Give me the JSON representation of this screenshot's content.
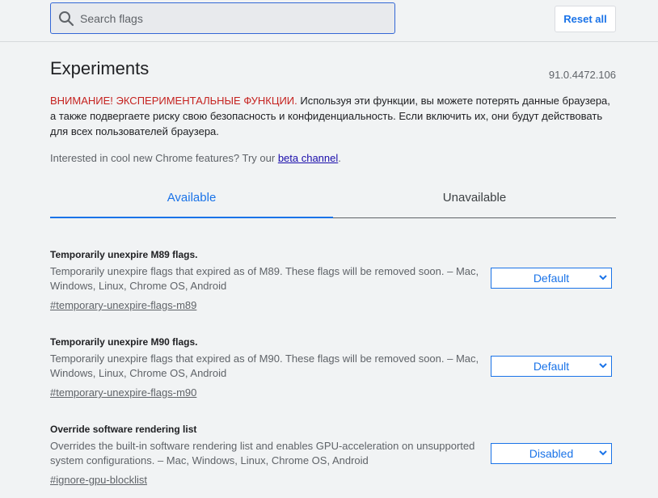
{
  "search": {
    "placeholder": "Search flags"
  },
  "header": {
    "reset_label": "Reset all"
  },
  "page": {
    "title": "Experiments",
    "version": "91.0.4472.106",
    "warning_red": "ВНИМАНИЕ! ЭКСПЕРИМЕНТАЛЬНЫЕ ФУНКЦИИ.",
    "warning_text": " Используя эти функции, вы можете потерять данные браузера, а также подвергаете риску свою безопасность и конфиденциальность. Если включить их, они будут действовать для всех пользователей браузера.",
    "interest_prefix": "Interested in cool new Chrome features? Try our ",
    "interest_link": "beta channel",
    "interest_suffix": "."
  },
  "tabs": [
    {
      "label": "Available",
      "active": true
    },
    {
      "label": "Unavailable",
      "active": false
    }
  ],
  "flags": [
    {
      "name": "Temporarily unexpire M89 flags.",
      "description": "Temporarily unexpire flags that expired as of M89. These flags will be removed soon. – Mac, Windows, Linux, Chrome OS, Android",
      "link": "#temporary-unexpire-flags-m89",
      "value": "Default"
    },
    {
      "name": "Temporarily unexpire M90 flags.",
      "description": "Temporarily unexpire flags that expired as of M90. These flags will be removed soon. – Mac, Windows, Linux, Chrome OS, Android",
      "link": "#temporary-unexpire-flags-m90",
      "value": "Default"
    },
    {
      "name": "Override software rendering list",
      "description": "Overrides the built-in software rendering list and enables GPU-acceleration on unsupported system configurations. – Mac, Windows, Linux, Chrome OS, Android",
      "link": "#ignore-gpu-blocklist",
      "value": "Disabled"
    }
  ],
  "colors": {
    "accent": "#1a73e8",
    "warning": "#c5221f"
  },
  "icons": {
    "search": "search-icon",
    "dropdown": "chevron-down-icon"
  }
}
